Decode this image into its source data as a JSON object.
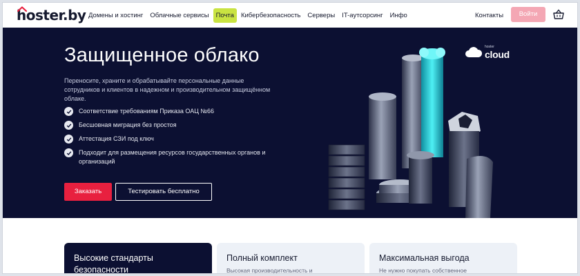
{
  "header": {
    "logo": "hoster.by",
    "nav": [
      "Домены и хостинг",
      "Облачные сервисы",
      "Почта",
      "Кибербезопасность",
      "Серверы",
      "IT-аутсорсинг",
      "Инфо"
    ],
    "highlighted_nav": "Почта",
    "contacts": "Контакты",
    "login": "Войти",
    "login_color": "#f4a7b4",
    "highlight_color": "#c9e341"
  },
  "hero": {
    "title": "Защищенное облако",
    "description": "Переносите, храните и обрабатывайте персональные данные сотрудников и клиентов в надежном и производительном защищённом облаке.",
    "features": [
      "Соответствие требованиям Приказа ОАЦ №66",
      "Бесшовная миграция без простоя",
      "Аттестация СЗИ под ключ",
      "Подходит для размещения ресурсов государственных органов и организаций"
    ],
    "order_button": "Заказать",
    "test_button": "Тестировать бесплатно",
    "brand_small": "hoster",
    "brand_word": "cloud",
    "background_color": "#0c1032",
    "accent_color": "#e8203f",
    "glow_color": "#19d3e0"
  },
  "cards": [
    {
      "title": "Высокие стандарты безопасности",
      "subtitle": "",
      "style": "dark"
    },
    {
      "title": "Полный комплект",
      "subtitle": "Высокая производительность и",
      "style": "light"
    },
    {
      "title": "Максимальная выгода",
      "subtitle": "Не нужно покупать собственное",
      "style": "light"
    }
  ]
}
